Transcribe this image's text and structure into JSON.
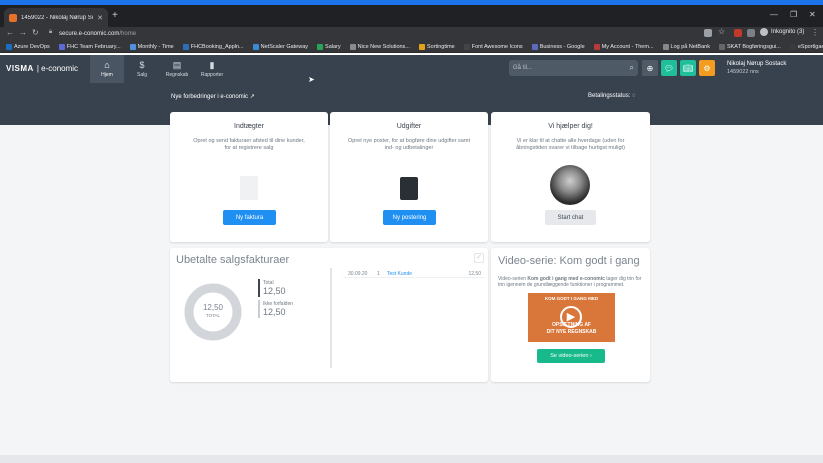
{
  "browser": {
    "tab_title": "1459022 - Nikolaj Nørup Sostack",
    "url_host": "secure.e-conomic.com",
    "url_path": "/home",
    "incognito_label": "Inkognito (3)",
    "bookmarks": [
      {
        "label": "Azure DevOps",
        "color": "#1b6ec2"
      },
      {
        "label": "FHC Team February...",
        "color": "#5b6bd6"
      },
      {
        "label": "Monthly - Time",
        "color": "#4f8fe0"
      },
      {
        "label": "FHCBooking_Appln...",
        "color": "#2f6db8"
      },
      {
        "label": "NetScaler Gateway",
        "color": "#3a8ad6"
      },
      {
        "label": "Salary",
        "color": "#27a559"
      },
      {
        "label": "Nice New Solutions...",
        "color": "#8a8a8a"
      },
      {
        "label": "Sortingtime",
        "color": "#e3a21a"
      },
      {
        "label": "Font Awesome Icons",
        "color": "#444444"
      },
      {
        "label": "Business - Google",
        "color": "#5c6bc0"
      },
      {
        "label": "My Account - Them...",
        "color": "#b83b3b"
      },
      {
        "label": "Log på NetBank",
        "color": "#888888"
      },
      {
        "label": "SKAT Bogføringsgui...",
        "color": "#666666"
      },
      {
        "label": "eSportlgaen",
        "color": "#3a3a3a"
      }
    ]
  },
  "app": {
    "logo": "VISMA",
    "logo_sub": "| e-conomic",
    "nav": [
      {
        "label": "Hjem",
        "icon": "⌂"
      },
      {
        "label": "Salg",
        "icon": "$"
      },
      {
        "label": "Regnskab",
        "icon": "▤"
      },
      {
        "label": "Rapporter",
        "icon": "▮"
      }
    ],
    "search_placeholder": "Gå til...",
    "user_name": "Nikolaj Nørup Sostack",
    "user_account": "1459022 nns",
    "new_features": "Nye forbedringer i e-conomic",
    "payment_status": "Betalingsstatus:",
    "colors": {
      "header": "#38424e",
      "blue": "#1f8ff2",
      "green": "#18b98a",
      "orange": "#f39c1f",
      "teal": "#1fbf9c"
    }
  },
  "cards": {
    "income": {
      "title": "Indtægter",
      "desc": "Opret og send fakturaer afsted til dine kunder, for at registrere salg",
      "button": "Ny faktura"
    },
    "expenses": {
      "title": "Udgifter",
      "desc": "Opret nye poster, for at bogføre dine udgifter samt ind- og udbetalinger",
      "button": "Ny postering"
    },
    "help": {
      "title": "Vi hjælper dig!",
      "desc": "Vi er klar til at chatte alle hverdage (uden for åbningstiden svarer vi tilbage hurtigst muligt)",
      "button": "Start chat"
    }
  },
  "unpaid": {
    "title": "Ubetalte salgsfakturaer",
    "donut_value": "12,50",
    "donut_label": "TOTAL",
    "legend_total_label": "Total",
    "legend_total_value": "12,50",
    "legend_notdue_label": "Ikke forfalden",
    "legend_notdue_value": "12,50",
    "invoices": [
      {
        "date": "30.09.20",
        "number": "1",
        "customer": "Test Kunde",
        "amount": "12,50"
      }
    ]
  },
  "video": {
    "title": "Video-serie: Kom godt i gang",
    "desc_prefix": "Video-serien ",
    "desc_bold": "Kom godt i gang med e-conomic",
    "desc_suffix": " tager dig trin for trin igennem de grundlæggende funktioner i programmet.",
    "thumb_line1": "KOM GODT I GANG MED",
    "thumb_line2": "OPSÆTNING AF",
    "thumb_line3": "DIT NYE REGNSKAB",
    "button": "Se video-serien"
  }
}
